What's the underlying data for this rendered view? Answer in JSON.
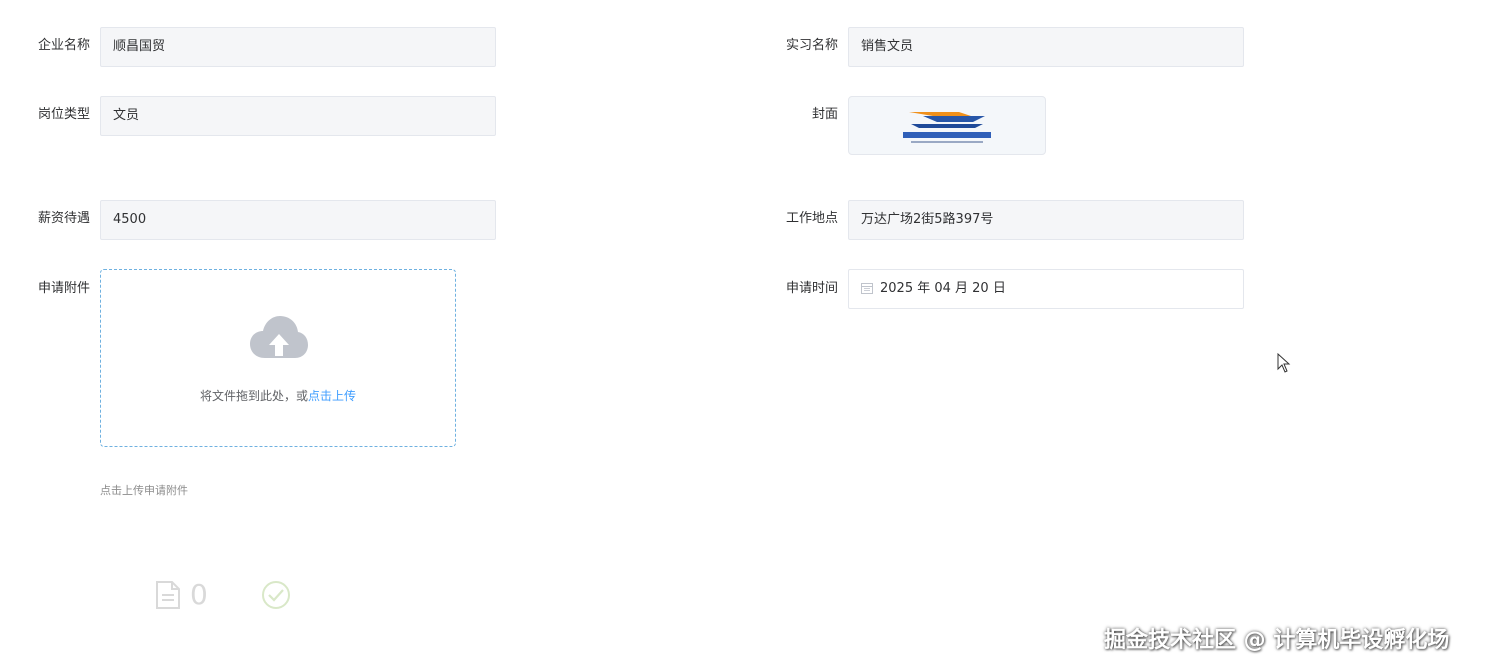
{
  "form": {
    "company": {
      "label": "企业名称",
      "value": "顺昌国贸"
    },
    "internship": {
      "label": "实习名称",
      "value": "销售文员"
    },
    "position": {
      "label": "岗位类型",
      "value": "文员"
    },
    "cover": {
      "label": "封面"
    },
    "salary": {
      "label": "薪资待遇",
      "value": "4500"
    },
    "location": {
      "label": "工作地点",
      "value": "万达广场2街5路397号"
    },
    "attachment": {
      "label": "申请附件",
      "drop_text": "将文件拖到此处，或",
      "upload_link": "点击上传",
      "tip": "点击上传申请附件"
    },
    "apply_time": {
      "label": "申请时间",
      "value": "2025 年 04 月 20 日"
    }
  },
  "footer": {
    "count": "0"
  },
  "watermark": "掘金技术社区 @ 计算机毕设孵化场",
  "colors": {
    "accent": "#409eff",
    "field_bg": "#f5f6f8",
    "border": "#e4e7ed"
  }
}
